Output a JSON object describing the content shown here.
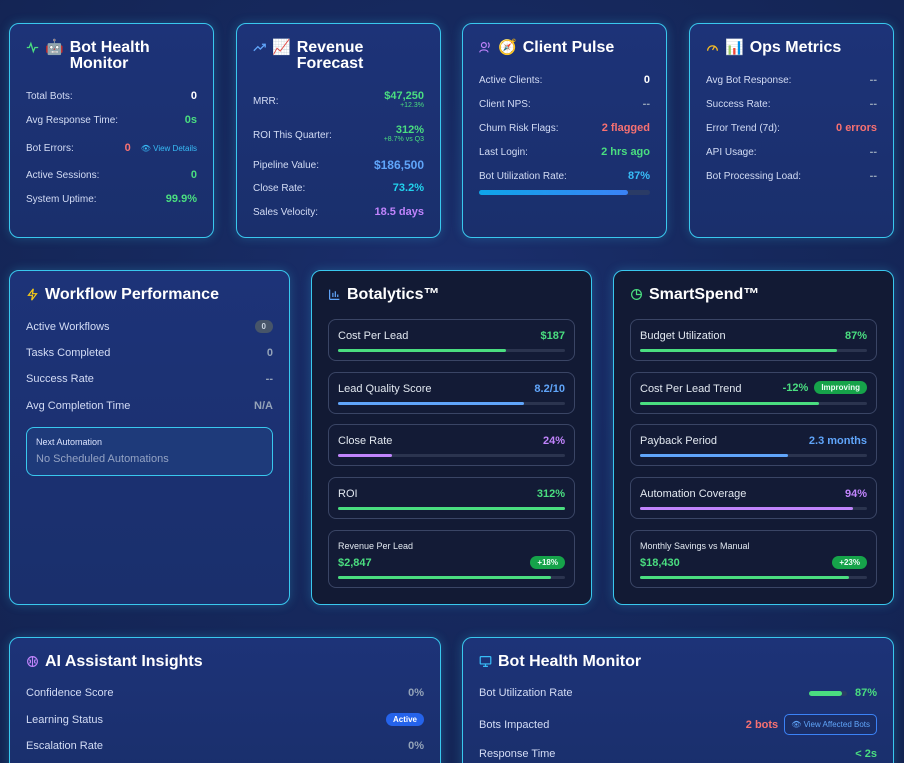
{
  "bot_health": {
    "title_line1": "Bot Health",
    "title_line2": "Monitor",
    "rows": [
      {
        "label": "Total Bots:",
        "value": "0"
      },
      {
        "label": "Avg Response Time:",
        "value": "0s"
      },
      {
        "label": "Bot Errors:",
        "value": "0",
        "link": "View Details"
      },
      {
        "label": "Active Sessions:",
        "value": "0"
      },
      {
        "label": "System Uptime:",
        "value": "99.9%"
      }
    ]
  },
  "revenue": {
    "title_line1": "Revenue",
    "title_line2": "Forecast",
    "mrr_label": "MRR:",
    "mrr_value": "$47,250",
    "mrr_sub": "+12.3%",
    "roi_label": "ROI This Quarter:",
    "roi_value": "312%",
    "roi_sub": "+8.7% vs Q3",
    "pipeline_label": "Pipeline Value:",
    "pipeline_value": "$186,500",
    "close_label": "Close Rate:",
    "close_value": "73.2%",
    "velocity_label": "Sales Velocity:",
    "velocity_value": "18.5 days"
  },
  "client_pulse": {
    "title": "Client Pulse",
    "rows": [
      {
        "label": "Active Clients:",
        "value": "0"
      },
      {
        "label": "Client NPS:",
        "value": "--"
      },
      {
        "label": "Churn Risk Flags:",
        "value": "2 flagged"
      },
      {
        "label": "Last Login:",
        "value": "2 hrs ago"
      },
      {
        "label": "Bot Utilization Rate:",
        "value": "87%"
      }
    ],
    "utilization_fraction": 0.87
  },
  "ops": {
    "title": "Ops Metrics",
    "rows": [
      {
        "label": "Avg Bot Response:",
        "value": "--"
      },
      {
        "label": "Success Rate:",
        "value": "--"
      },
      {
        "label": "Error Trend (7d):",
        "value": "0 errors"
      },
      {
        "label": "API Usage:",
        "value": "--"
      },
      {
        "label": "Bot Processing Load:",
        "value": "--"
      }
    ]
  },
  "workflow": {
    "title": "Workflow Performance",
    "rows": [
      {
        "label": "Active Workflows",
        "value": "0"
      },
      {
        "label": "Tasks Completed",
        "value": "0"
      },
      {
        "label": "Success Rate",
        "value": "--"
      },
      {
        "label": "Avg Completion Time",
        "value": "N/A"
      }
    ],
    "next_label": "Next Automation",
    "next_value": "No Scheduled Automations"
  },
  "botalytics": {
    "title": "Botalytics™",
    "metrics": [
      {
        "label": "Cost Per Lead",
        "value": "$187",
        "fill": 0.74,
        "color": "#4ade80"
      },
      {
        "label": "Lead Quality Score",
        "value": "8.2/10",
        "fill": 0.82,
        "color": "#60a5fa"
      },
      {
        "label": "Close Rate",
        "value": "24%",
        "fill": 0.24,
        "color": "#c084fc"
      },
      {
        "label": "ROI",
        "value": "312%",
        "fill": 1.0,
        "color": "#4ade80"
      }
    ],
    "rpl_label": "Revenue Per Lead",
    "rpl_value": "$2,847",
    "rpl_badge": "+18%",
    "rpl_fill": 0.94
  },
  "smartspend": {
    "title": "SmartSpend™",
    "metrics": [
      {
        "label": "Budget Utilization",
        "value": "87%",
        "fill": 0.87,
        "color": "#4ade80"
      },
      {
        "label": "Cost Per Lead Trend",
        "value": "-12%",
        "badge": "Improving",
        "fill": 0.79,
        "color": "#4ade80"
      },
      {
        "label": "Payback Period",
        "value": "2.3 months",
        "fill": 0.65,
        "color": "#60a5fa"
      },
      {
        "label": "Automation Coverage",
        "value": "94%",
        "fill": 0.94,
        "color": "#c084fc"
      }
    ],
    "msm_label": "Monthly Savings vs Manual",
    "msm_value": "$18,430",
    "msm_badge": "+23%",
    "msm_fill": 0.92
  },
  "ai": {
    "title": "AI Assistant Insights",
    "rows": [
      {
        "label": "Confidence Score",
        "value": "0%"
      },
      {
        "label": "Learning Status",
        "value": "Active"
      },
      {
        "label": "Escalation Rate",
        "value": "0%"
      }
    ]
  },
  "bot_health2": {
    "title": "Bot Health Monitor",
    "util_label": "Bot Utilization Rate",
    "util_value": "87%",
    "util_fraction": 0.87,
    "impacted_label": "Bots Impacted",
    "impacted_value": "2 bots",
    "impacted_button": "View Affected Bots",
    "response_label": "Response Time",
    "response_value": "< 2s"
  },
  "colors": {
    "border": "#39c8ee",
    "green": "#4ade80",
    "red": "#f87171",
    "blue": "#60a5fa",
    "purple": "#c084fc"
  }
}
